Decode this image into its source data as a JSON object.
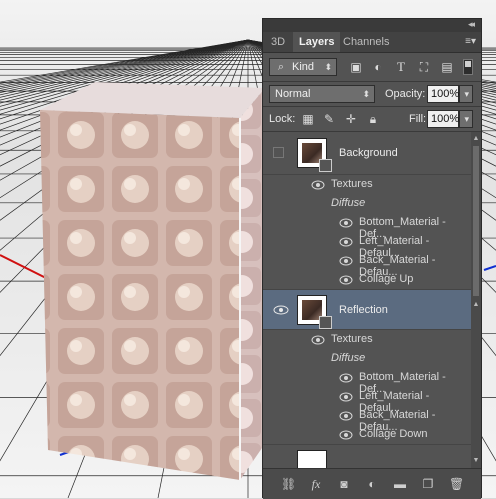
{
  "tabs": [
    "3D",
    "Layers",
    "Channels"
  ],
  "filter": {
    "label": "Kind"
  },
  "blend": {
    "mode": "Normal",
    "opacity_label": "Opacity:",
    "opacity": "100%"
  },
  "lock": {
    "label": "Lock:",
    "fill_label": "Fill:",
    "fill": "100%"
  },
  "layers": [
    {
      "name": "Background",
      "textures_label": "Textures",
      "diffuse_label": "Diffuse",
      "items": [
        "Bottom_Material - Def...",
        "Left_Material - Defaul...",
        "Back_Material - Defau...",
        "Collage Up"
      ]
    },
    {
      "name": "Reflection",
      "textures_label": "Textures",
      "diffuse_label": "Diffuse",
      "items": [
        "Bottom_Material - Def...",
        "Left_Material - Defaul...",
        "Back_Material - Defau...",
        "Collage Down"
      ]
    }
  ],
  "colors": {
    "panel": "#535353",
    "selected_row": "#5b6b80",
    "grid_line": "#222222",
    "axis_red": "#d01010",
    "axis_blue": "#1030d0"
  },
  "icons": [
    "collapse-icon",
    "panel-menu-icon",
    "search-icon",
    "pixel-filter-icon",
    "adjustment-filter-icon",
    "type-filter-icon",
    "shape-filter-icon",
    "smart-object-filter-icon",
    "filter-toggle-icon",
    "lock-transparent-icon",
    "lock-paint-icon",
    "lock-move-icon",
    "lock-all-icon",
    "eye-icon",
    "link-icon",
    "fx-icon",
    "mask-icon",
    "adjustment-icon",
    "folder-icon",
    "new-layer-icon",
    "trash-icon"
  ]
}
